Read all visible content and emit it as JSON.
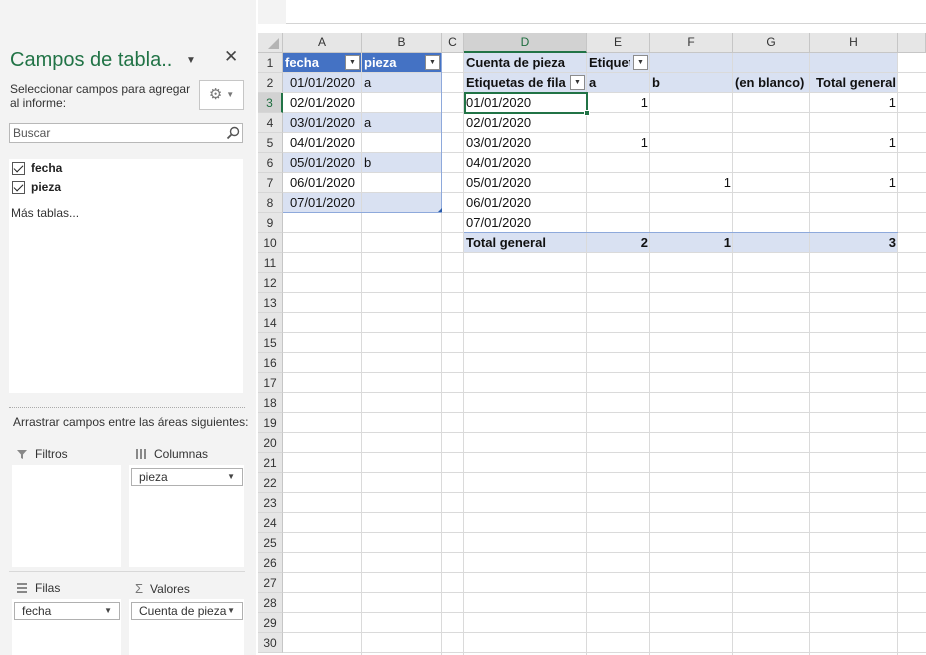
{
  "task_pane": {
    "title": "Campos de tabla..",
    "instruction": "Seleccionar campos para agregar al informe:",
    "search_placeholder": "Buscar",
    "fields": [
      {
        "label": "fecha",
        "checked": true
      },
      {
        "label": "pieza",
        "checked": true
      }
    ],
    "more_tables": "Más tablas...",
    "drag_instruction": "Arrastrar campos entre las áreas siguientes:",
    "areas": {
      "filters": {
        "label": "Filtros",
        "items": []
      },
      "columns": {
        "label": "Columnas",
        "items": [
          "pieza"
        ]
      },
      "rows": {
        "label": "Filas",
        "items": [
          "fecha"
        ]
      },
      "values": {
        "label": "Valores",
        "items": [
          "Cuenta de pieza"
        ]
      }
    }
  },
  "sheet": {
    "columns": [
      "A",
      "B",
      "C",
      "D",
      "E",
      "F",
      "G",
      "H"
    ],
    "selected_column": "D",
    "rows": [
      "1",
      "2",
      "3",
      "4",
      "5",
      "6",
      "7",
      "8",
      "9",
      "10",
      "11",
      "12",
      "13",
      "14",
      "15",
      "16",
      "17",
      "18",
      "19",
      "20",
      "21",
      "22",
      "23",
      "24",
      "25",
      "26",
      "27",
      "28",
      "29",
      "30"
    ],
    "selected_row": "3",
    "table": {
      "headers": [
        "fecha",
        "pieza"
      ],
      "rows": [
        [
          "01/01/2020",
          "a"
        ],
        [
          "02/01/2020",
          ""
        ],
        [
          "03/01/2020",
          "a"
        ],
        [
          "04/01/2020",
          ""
        ],
        [
          "05/01/2020",
          "b"
        ],
        [
          "06/01/2020",
          ""
        ],
        [
          "07/01/2020",
          ""
        ]
      ]
    },
    "pivot": {
      "value_label": "Cuenta de pieza",
      "column_labels": "Etiquetas de columna",
      "row_labels": "Etiquetas de fila",
      "col_headers": [
        "a",
        "b",
        "(en blanco)",
        "Total general"
      ],
      "rows": [
        [
          "01/01/2020",
          "1",
          "",
          "",
          "1"
        ],
        [
          "02/01/2020",
          "",
          "",
          "",
          ""
        ],
        [
          "03/01/2020",
          "1",
          "",
          "",
          "1"
        ],
        [
          "04/01/2020",
          "",
          "",
          "",
          ""
        ],
        [
          "05/01/2020",
          "",
          "1",
          "",
          "1"
        ],
        [
          "06/01/2020",
          "",
          "",
          "",
          ""
        ],
        [
          "07/01/2020",
          "",
          "",
          "",
          ""
        ]
      ],
      "total": [
        "Total general",
        "2",
        "1",
        "",
        "3"
      ]
    }
  },
  "colors": {
    "accent": "#217346",
    "table_header": "#4472c4",
    "table_band": "#d9e1f2",
    "pivot_header": "#d9e1f2"
  }
}
